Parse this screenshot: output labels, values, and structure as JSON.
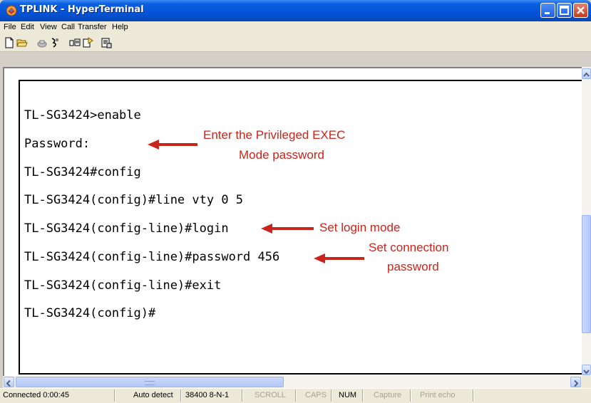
{
  "window": {
    "title": "TPLINK - HyperTerminal"
  },
  "menu": [
    "File",
    "Edit",
    "View",
    "Call",
    "Transfer",
    "Help"
  ],
  "toolbar_icons": [
    "new-document-icon",
    "open-folder-icon",
    "call-icon",
    "disconnect-icon",
    "send-icon",
    "receive-icon",
    "properties-icon"
  ],
  "terminal": {
    "lines": [
      "TL-SG3424>enable",
      "Password:",
      "TL-SG3424#config",
      "TL-SG3424(config)#line vty 0 5",
      "TL-SG3424(config-line)#login",
      "TL-SG3424(config-line)#password 456",
      "TL-SG3424(config-line)#exit",
      "TL-SG3424(config)#"
    ]
  },
  "annotations": {
    "privileged_line1": "Enter the  Privileged  EXEC",
    "privileged_line2": "Mode  password",
    "login": "Set login  mode",
    "connection_line1": "Set  connection",
    "connection_line2": "password"
  },
  "status": {
    "connected": "Connected 0:00:45",
    "detect": "Auto detect",
    "settings": "38400 8-N-1",
    "scroll": "SCROLL",
    "caps": "CAPS",
    "num": "NUM",
    "capture": "Capture",
    "print_echo": "Print echo"
  },
  "colors": {
    "titlebar": "#0554d8",
    "annotation": "#c8251c",
    "close_button": "#c5391c"
  }
}
